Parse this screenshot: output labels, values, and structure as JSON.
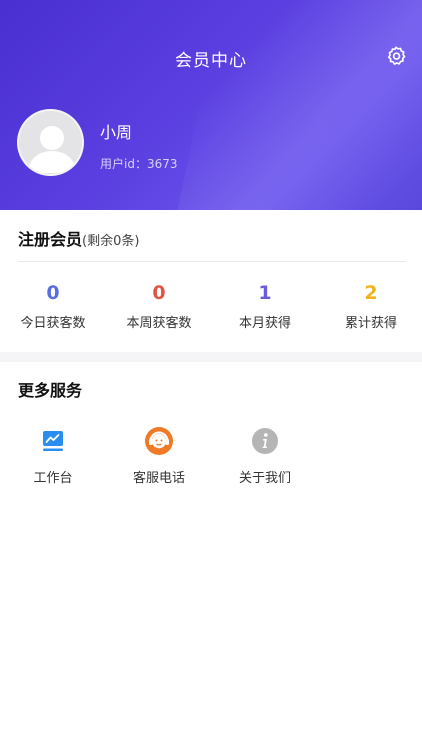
{
  "header": {
    "title": "会员中心",
    "settings_icon": "gear-icon"
  },
  "profile": {
    "name": "小周",
    "user_id_label": "用户id：3673"
  },
  "registration": {
    "title": "注册会员",
    "remaining": "(剩余0条)",
    "stats": [
      {
        "value": "0",
        "label": "今日获客数",
        "color": "#5a6ee0"
      },
      {
        "value": "0",
        "label": "本周获客数",
        "color": "#e0553f"
      },
      {
        "value": "1",
        "label": "本月获得",
        "color": "#6a5ae0"
      },
      {
        "value": "2",
        "label": "累计获得",
        "color": "#f0b31e"
      }
    ]
  },
  "services": {
    "title": "更多服务",
    "items": [
      {
        "label": "工作台",
        "icon": "chart-icon",
        "color": "#2a8df0"
      },
      {
        "label": "客服电话",
        "icon": "headset-icon",
        "color": "#f07a25"
      },
      {
        "label": "关于我们",
        "icon": "info-icon",
        "color": "#b5b5b5"
      }
    ]
  }
}
